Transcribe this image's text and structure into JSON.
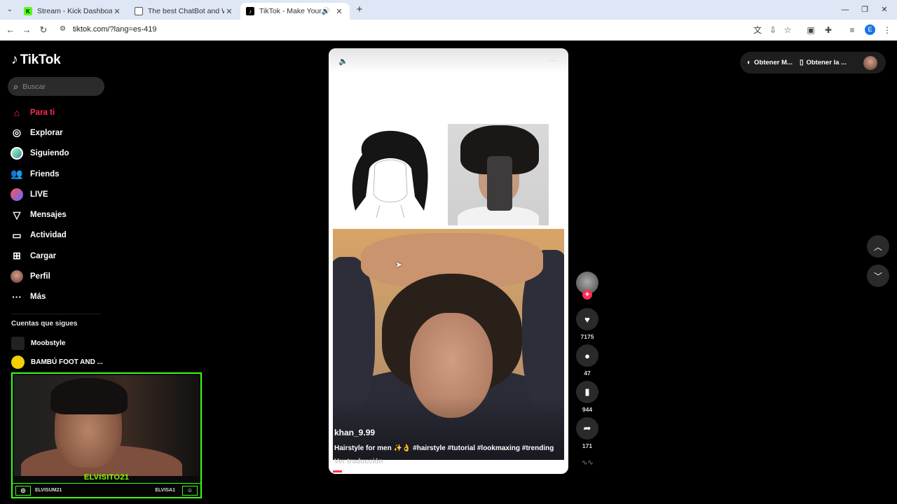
{
  "browser": {
    "tabs": [
      {
        "title": "Stream - Kick Dashboard",
        "favicon_color": "#53fc18",
        "favicon_letter": "K"
      },
      {
        "title": "The best ChatBot and Widgets",
        "favicon_color": "#2b2b2b",
        "favicon_letter": ""
      },
      {
        "title": "TikTok - Make Your Day",
        "favicon_color": "#000000",
        "favicon_letter": "♪"
      }
    ],
    "active_tab_index": 2,
    "url": "tiktok.com/?lang=es-419",
    "profile_initial": "E"
  },
  "tiktok": {
    "logo_text": "TikTok",
    "search_placeholder": "Buscar",
    "nav": [
      {
        "label": "Para ti",
        "icon": "home-icon",
        "active": true
      },
      {
        "label": "Explorar",
        "icon": "compass-icon"
      },
      {
        "label": "Siguiendo",
        "icon": "following-avatar-icon"
      },
      {
        "label": "Friends",
        "icon": "friends-icon"
      },
      {
        "label": "LIVE",
        "icon": "live-icon"
      },
      {
        "label": "Mensajes",
        "icon": "messages-icon"
      },
      {
        "label": "Actividad",
        "icon": "activity-icon"
      },
      {
        "label": "Cargar",
        "icon": "upload-icon"
      },
      {
        "label": "Perfil",
        "icon": "profile-avatar-icon"
      },
      {
        "label": "Más",
        "icon": "more-icon"
      }
    ],
    "following_title": "Cuentas que sigues",
    "following": [
      {
        "name": "Moobstyle"
      },
      {
        "name": "BAMBÚ FOOT AND ..."
      }
    ],
    "top_pill": {
      "item1": "Obtener M...",
      "item2": "Obtener la ..."
    },
    "video": {
      "author": "khan_9.99",
      "caption": "Hairstyle for men ✨👌 #hairstyle #tutorial #lookmaxing #trending",
      "translate": "Ver traducción",
      "progress": 0.04
    },
    "actions": {
      "likes": "7175",
      "comments": "47",
      "saves": "944",
      "shares": "171"
    }
  },
  "webcam": {
    "name": "ELVISITO21",
    "left_handle": "ELVISUM21",
    "right_handle": "ELVISA1"
  },
  "colors": {
    "accent": "#fe2c55",
    "webcam_green": "#39ff14"
  }
}
